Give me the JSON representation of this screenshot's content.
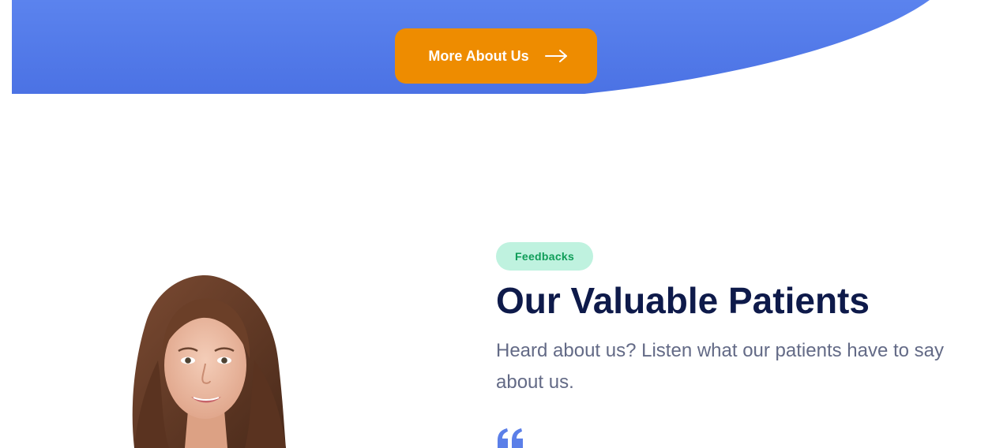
{
  "hero": {
    "cta_label": "More About Us",
    "cta_icon": "arrow-right-icon",
    "band_color_top": "#5b83ee",
    "band_color_bottom": "#4b72e4",
    "cta_color": "#ee8c00"
  },
  "testimonials": {
    "badge_label": "Feedbacks",
    "title": "Our Valuable Patients",
    "subtitle": "Heard about us? Listen what our patients have to say about us.",
    "quote_icon": "quote-icon",
    "badge_color": "#bff2df",
    "title_color": "#0e1a4a",
    "accent_color": "#5b7fe8"
  },
  "patient": {
    "photo": "patient-photo"
  }
}
